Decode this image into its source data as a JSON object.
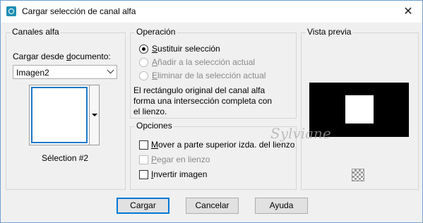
{
  "window": {
    "title": "Cargar selección de canal alfa",
    "close_symbol": "✕"
  },
  "canales": {
    "group_label": "Canales alfa",
    "load_label_pre": "Cargar desde ",
    "load_label_ul": "d",
    "load_label_post": "ocumento:",
    "document_value": "Imagen2",
    "selection_name": "Sélection #2"
  },
  "operacion": {
    "group_label": "Operación",
    "options": [
      {
        "pre": "",
        "ul": "S",
        "post": "ustituir selección",
        "selected": true,
        "enabled": true
      },
      {
        "pre": "",
        "ul": "A",
        "post": "ñadir a la selección actual",
        "selected": false,
        "enabled": false
      },
      {
        "pre": "",
        "ul": "E",
        "post": "liminar de la selección actual",
        "selected": false,
        "enabled": false
      }
    ],
    "description_line1": "El rectángulo original del canal alfa",
    "description_line2": "forma una intersección completa con",
    "description_line3": "el lienzo."
  },
  "opciones": {
    "group_label": "Opciones",
    "checks": [
      {
        "pre": "",
        "ul": "M",
        "post": "over a parte superior izda. del lienzo",
        "checked": false,
        "enabled": true
      },
      {
        "pre": "",
        "ul": "P",
        "post": "egar en lienzo",
        "checked": false,
        "enabled": false
      },
      {
        "pre": "",
        "ul": "I",
        "post": "nvertir imagen",
        "checked": false,
        "enabled": true
      }
    ]
  },
  "vista_previa": {
    "group_label": "Vista previa"
  },
  "buttons": {
    "ok": "Cargar",
    "cancel": "Cancelar",
    "help": "Ayuda"
  },
  "watermark_text": "Sylviane",
  "icons": {
    "app": "paint-app-icon",
    "zoom": "checker-zoom-icon",
    "dropdown": "chevron-down-icon"
  }
}
